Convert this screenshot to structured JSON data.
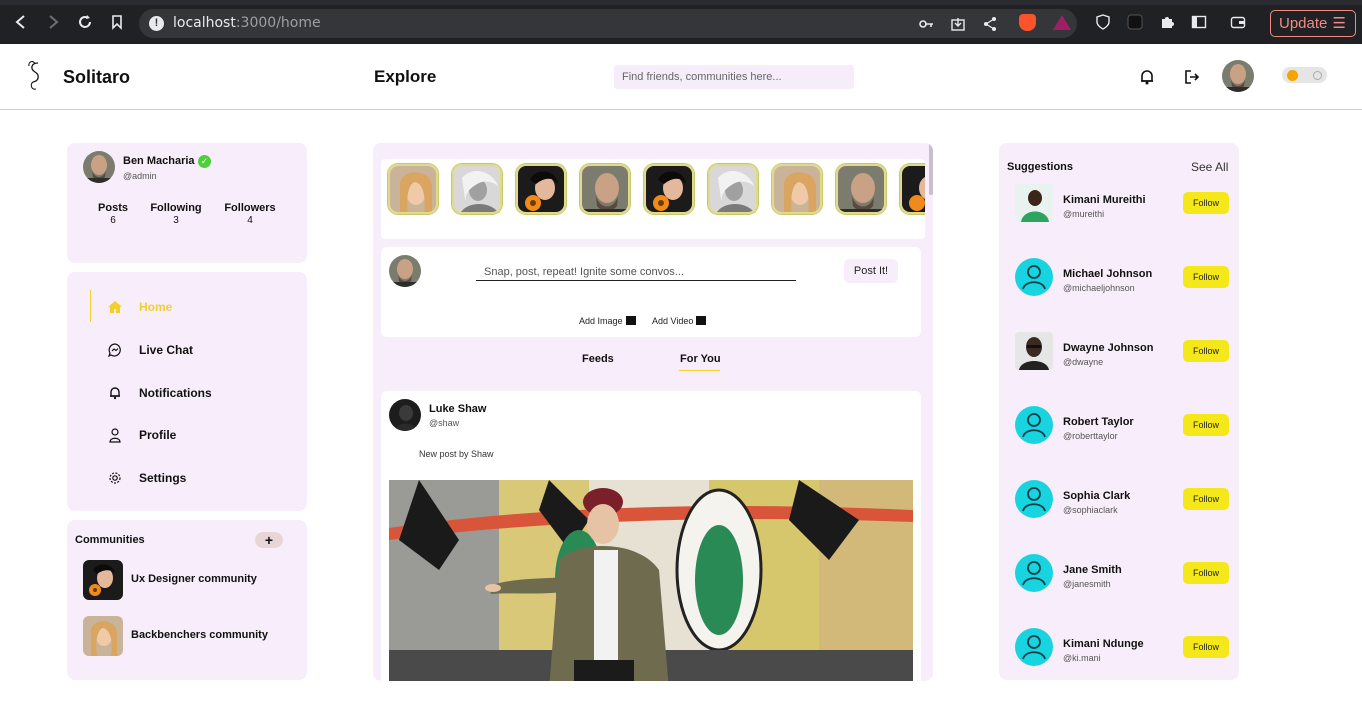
{
  "browser": {
    "url_host": "localhost",
    "url_path": ":3000/home",
    "update_label": "Update"
  },
  "header": {
    "brand": "Solitaro",
    "page_title": "Explore",
    "search_placeholder": "Find friends, communities here..."
  },
  "profile": {
    "name": "Ben Macharia",
    "handle": "@admin",
    "stats": [
      {
        "label": "Posts",
        "value": "6"
      },
      {
        "label": "Following",
        "value": "3"
      },
      {
        "label": "Followers",
        "value": "4"
      }
    ]
  },
  "nav": {
    "home": "Home",
    "live_chat": "Live Chat",
    "notifications": "Notifications",
    "profile": "Profile",
    "settings": "Settings"
  },
  "communities": {
    "title": "Communities",
    "add_label": "+",
    "items": [
      {
        "name": "Ux Designer community"
      },
      {
        "name": "Backbenchers community"
      }
    ]
  },
  "composer": {
    "placeholder": "Snap, post, repeat! Ignite some convos...",
    "post_button": "Post It!",
    "add_image": "Add Image",
    "add_video": "Add Video"
  },
  "tabs": {
    "feeds": "Feeds",
    "for_you": "For You"
  },
  "post": {
    "author": "Luke Shaw",
    "handle": "@shaw",
    "text": "New post by Shaw"
  },
  "suggestions": {
    "title": "Suggestions",
    "see_all": "See All",
    "follow_label": "Follow",
    "items": [
      {
        "name": "Kimani Mureithi",
        "handle": "@mureithi"
      },
      {
        "name": "Michael Johnson",
        "handle": "@michaeljohnson"
      },
      {
        "name": "Dwayne Johnson",
        "handle": "@dwayne"
      },
      {
        "name": "Robert Taylor",
        "handle": "@roberttaylor"
      },
      {
        "name": "Sophia Clark",
        "handle": "@sophiaclark"
      },
      {
        "name": "Jane Smith",
        "handle": "@janesmith"
      },
      {
        "name": "Kimani Ndunge",
        "handle": "@ki.mani"
      }
    ]
  },
  "colors": {
    "accent": "#f3cf2e",
    "follow": "#f5e81a",
    "card_bg": "#f8eefb",
    "avatar_cyan": "#17d4e0"
  }
}
